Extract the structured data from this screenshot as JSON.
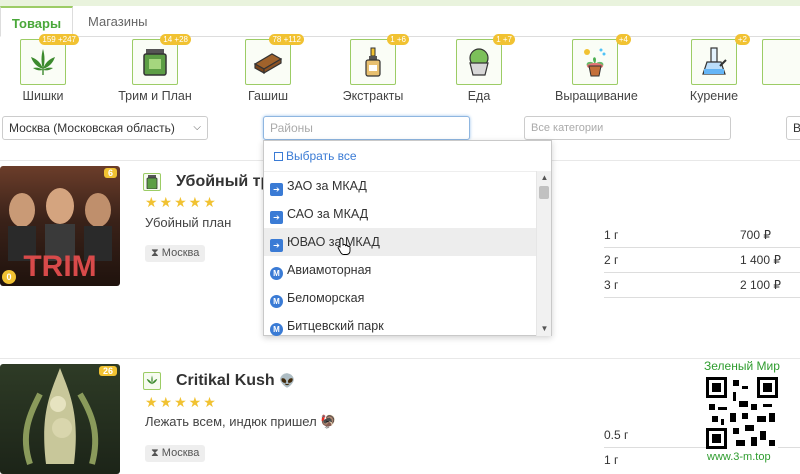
{
  "tabs": [
    {
      "label": "Товары",
      "active": true
    },
    {
      "label": "Магазины",
      "active": false
    }
  ],
  "categories": [
    {
      "label": "Шишки",
      "badge": "159 +247",
      "icon": "cannabis-leaf-icon"
    },
    {
      "label": "Трим и План",
      "badge": "14 +28",
      "icon": "jar-icon"
    },
    {
      "label": "Гашиш",
      "badge": "78 +112",
      "icon": "hash-brick-icon"
    },
    {
      "label": "Экстракты",
      "badge": "1 +6",
      "icon": "dropper-bottle-icon"
    },
    {
      "label": "Еда",
      "badge": "1 +7",
      "icon": "cupcake-icon"
    },
    {
      "label": "Выращивание",
      "badge": "+4",
      "icon": "plant-pot-icon"
    },
    {
      "label": "Курение",
      "badge": "+2",
      "icon": "bong-icon"
    }
  ],
  "filters": {
    "city": "Москва (Московская область)",
    "district_placeholder": "Районы",
    "category_placeholder": "Все категории",
    "extra": "В"
  },
  "dropdown": {
    "select_all": "Выбрать все",
    "items": [
      {
        "label": "ЗАО за МКАД",
        "type": "district"
      },
      {
        "label": "САО за МКАД",
        "type": "district"
      },
      {
        "label": "ЮВАО за МКАД",
        "type": "district",
        "hover": true
      },
      {
        "label": "Авиамоторная",
        "type": "metro"
      },
      {
        "label": "Беломорская",
        "type": "metro"
      },
      {
        "label": "Битцевский парк",
        "type": "metro"
      }
    ]
  },
  "products": [
    {
      "title": "Убойный тр",
      "description": "Убойный план",
      "location": "Москва",
      "image_text": "TRIM",
      "corner_badge": "6",
      "coin": "0",
      "rating": 5,
      "prices": [
        {
          "qty": "1 г",
          "price": "700 ₽"
        },
        {
          "qty": "2 г",
          "price": "1 400 ₽"
        },
        {
          "qty": "3 г",
          "price": "2 100 ₽"
        }
      ]
    },
    {
      "title": "Critikal Kush",
      "description": "Лежать всем, индюк пришел",
      "location": "Москва",
      "corner_badge": "26",
      "rating": 5,
      "prices": [
        {
          "qty": "0.5 г",
          "price": ""
        },
        {
          "qty": "1 г",
          "price": ""
        }
      ]
    }
  ],
  "promo": {
    "title": "Зеленый Мир",
    "url": "www.3-m.top"
  },
  "colors": {
    "accent_green": "#9ccc65",
    "star_gold": "#f1c232",
    "link_blue": "#3a7bd5",
    "promo_green": "#2e9c2e"
  }
}
